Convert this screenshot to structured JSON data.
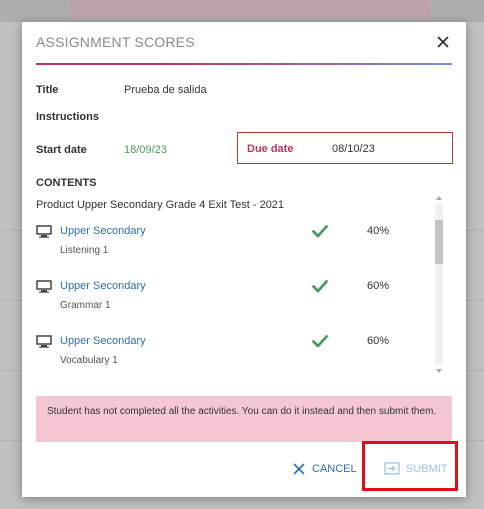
{
  "modal": {
    "title": "ASSIGNMENT SCORES"
  },
  "details": {
    "title_label": "Title",
    "title_value": "Prueba de salida",
    "instructions_label": "Instructions",
    "start_label": "Start date",
    "start_value": "18/09/23",
    "due_label": "Due date",
    "due_value": "08/10/23",
    "contents_label": "CONTENTS"
  },
  "contents": {
    "product_title": "Product Upper Secondary Grade 4 Exit Test - 2021",
    "items": [
      {
        "link": "Upper Secondary",
        "sub": "Listening 1",
        "score": "40%"
      },
      {
        "link": "Upper Secondary",
        "sub": "Grammar 1",
        "score": "60%"
      },
      {
        "link": "Upper Secondary",
        "sub": "Vocabulary 1",
        "score": "60%"
      }
    ]
  },
  "alert": {
    "text": "Student has not completed all the activities. You can do it instead and then submit them."
  },
  "actions": {
    "cancel_label": "CANCEL",
    "submit_label": "SUBMIT"
  },
  "colors": {
    "accent_pink": "#c0335a",
    "link_blue": "#2f6db5",
    "check_green": "#4a9a5c",
    "alert_bg": "#f5c7d3",
    "highlight_red": "#e0101b"
  },
  "icons": {
    "close": "close-icon",
    "item": "monitor-icon",
    "done": "checkmark-icon",
    "cancel": "x-icon",
    "submit": "submit-icon"
  }
}
